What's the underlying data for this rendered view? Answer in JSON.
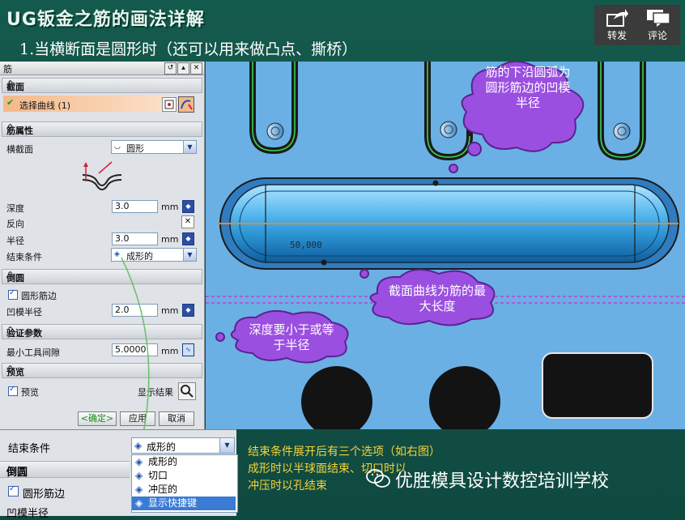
{
  "slide": {
    "title": "UG钣金之筋的画法详解",
    "subtitle": "1.当横断面是圆形时（还可以用来做凸点、撕桥）",
    "share_label": "转发",
    "comment_label": "评论"
  },
  "dialog": {
    "title": "筋",
    "sections": {
      "section": "截面",
      "attributes": "筋属性",
      "fillet": "倒圆",
      "verify": "验证参数",
      "preview": "预览"
    },
    "select_curve": "选择曲线 (1)",
    "cross_section_label": "横截面",
    "cross_section_value": "圆形",
    "depth_label": "深度",
    "depth_value": "3.0",
    "depth_unit": "mm",
    "reverse_label": "反向",
    "radius_label": "半径",
    "radius_value": "3.0",
    "radius_unit": "mm",
    "end_condition_label": "结束条件",
    "end_condition_value": "成形的",
    "round_rib_label": "圆形筋边",
    "punch_radius_label": "凹模半径",
    "punch_radius_value": "2.0",
    "punch_radius_unit": "mm",
    "min_gap_label": "最小工具间隙",
    "min_gap_value": "5.0000",
    "min_gap_unit": "mm",
    "preview_label": "预览",
    "show_result": "显示结果",
    "ok": "<确定>",
    "apply": "应用",
    "cancel": "取消"
  },
  "canvas": {
    "dimension": "50,000",
    "cloud1": "筋的下沿圆弧为圆形筋边的凹模半径",
    "cloud2": "截面曲线为筋的最大长度",
    "cloud3": "深度要小于或等于半径"
  },
  "zoom": {
    "end_condition_label": "结束条件",
    "end_condition_value": "成形的",
    "fillet": "倒圆",
    "round_rib_label": "圆形筋边",
    "punch_radius_cut": "凹模半径",
    "options": [
      "成形的",
      "切口",
      "冲压的",
      "显示快捷键"
    ]
  },
  "notes": [
    "结束条件展开后有三个选项（如右图）",
    "成形时以半球面结束、切口时以",
    "冲压时以孔结束"
  ],
  "brand": "优胜模具设计数控培训学校",
  "colors": {
    "accent": "#f5d33a",
    "cloud": "#9b4fe0",
    "canvas": "#6ab0e4"
  }
}
